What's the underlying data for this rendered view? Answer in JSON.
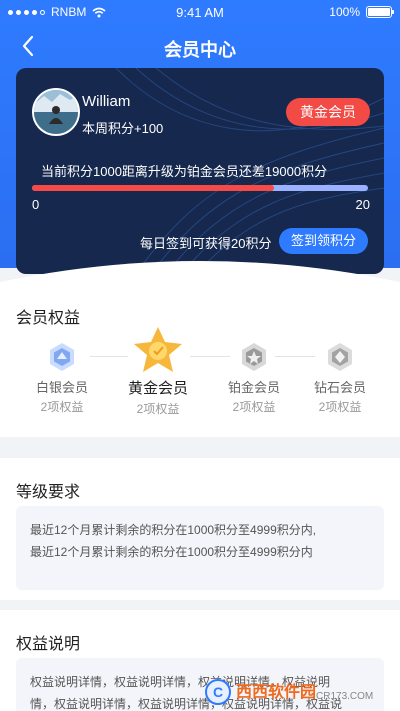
{
  "status_bar": {
    "carrier": "RNBM",
    "time": "9:41 AM",
    "battery": "100%"
  },
  "nav": {
    "title": "会员中心"
  },
  "member_card": {
    "username": "William",
    "weekly_points": "本周积分+100",
    "level_badge": "黄金会员",
    "upgrade_text": "当前积分1000距离升级为铂金会员还差19000积分",
    "progress_fraction": 0.72,
    "progress_min": "0",
    "progress_max": "20",
    "signin_note": "每日签到可获得20积分",
    "signin_button": "签到领积分"
  },
  "benefits": {
    "title": "会员权益",
    "tiers": [
      {
        "name": "白银会员",
        "count": "2项权益"
      },
      {
        "name": "黄金会员",
        "count": "2项权益",
        "active": true
      },
      {
        "name": "铂金会员",
        "count": "2项权益"
      },
      {
        "name": "钻石会员",
        "count": "2项权益"
      }
    ]
  },
  "requirements": {
    "title": "等级要求",
    "lines": [
      "最近12个月累计剩余的积分在1000积分至4999积分内,",
      "最近12个月累计剩余的积分在1000积分至4999积分内"
    ]
  },
  "explanation": {
    "title": "权益说明",
    "lines": [
      "权益说明详情，权益说明详情，权益说明详情，权益说明",
      "情，权益说明详情，权益说明详情，权益说明详情，权益说"
    ]
  },
  "watermark": {
    "text": "西西软件园",
    "url_text": "CR173.COM"
  }
}
